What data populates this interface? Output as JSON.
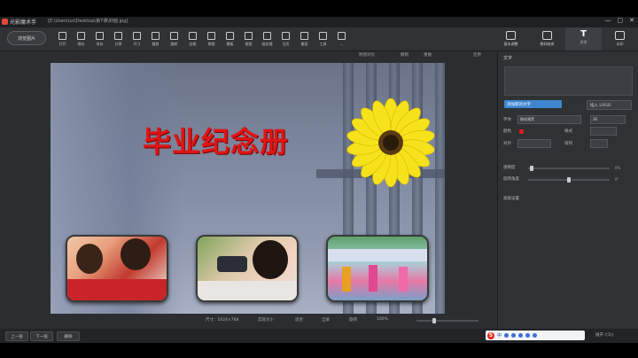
{
  "window": {
    "app_title": "光影魔术手",
    "path": "[E:\\Users\\xx\\Desktop\\第7课\\封面.jpg]",
    "controls": [
      "—",
      "▢",
      "✕"
    ]
  },
  "toolbar": {
    "open_button": "浏览图片",
    "tools": [
      {
        "label": "打开",
        "icon": "open-icon"
      },
      {
        "label": "保存",
        "icon": "save-icon"
      },
      {
        "label": "另存",
        "icon": "save-as-icon"
      },
      {
        "label": "分享",
        "icon": "share-icon"
      },
      {
        "label": "尺寸",
        "icon": "resize-icon"
      },
      {
        "label": "裁剪",
        "icon": "crop-icon"
      },
      {
        "label": "旋转",
        "icon": "rotate-icon"
      },
      {
        "label": "边框",
        "icon": "border-icon"
      },
      {
        "label": "拼图",
        "icon": "collage-icon"
      },
      {
        "label": "模板",
        "icon": "template-icon"
      },
      {
        "label": "抠图",
        "icon": "cutout-icon"
      },
      {
        "label": "批处理",
        "icon": "batch-icon"
      },
      {
        "label": "日历",
        "icon": "calendar-icon"
      },
      {
        "label": "美容",
        "icon": "beauty-icon"
      },
      {
        "label": "工具",
        "icon": "tools-icon"
      },
      {
        "label": "...",
        "icon": "more-icon"
      }
    ],
    "right_tabs": [
      {
        "label": "基本调整",
        "icon": "adjust-icon"
      },
      {
        "label": "数码暗房",
        "icon": "camera-icon"
      },
      {
        "label": "文字",
        "icon": "text-icon"
      },
      {
        "label": "水印",
        "icon": "watermark-icon"
      }
    ]
  },
  "subbar": {
    "compare": "原图对比",
    "undo": "撤销",
    "redo": "重做",
    "restore": "还原"
  },
  "canvas": {
    "title_text": "毕业纪念册",
    "colors": {
      "title": "#e01515",
      "petal": "#f5e21b",
      "center": "#3b2a12"
    }
  },
  "statusbar": {
    "size": "尺寸：1024×768",
    "actual": "实际大小",
    "fit": "适合",
    "fullscreen": "全屏",
    "rotate": "旋转",
    "zoom_value": "100%"
  },
  "bottom": {
    "prev": "上一张",
    "next": "下一张",
    "delete": "删除",
    "ime_lang": "中",
    "right_text": "展开 ((1))"
  },
  "panel": {
    "header": "文字",
    "new_text_button": "添加新的文字",
    "insert_button": "插入 LOGO",
    "font_label": "字体",
    "font_value": "微软雅黑",
    "size_value": "36",
    "color_label": "颜色",
    "style_label": "样式",
    "align_label": "对齐",
    "spacing_label": "排列",
    "opacity_label": "透明度",
    "opacity_value": "0%",
    "rotate_label": "旋转角度",
    "rotate_value": "0°",
    "advanced_label": "高级设置"
  }
}
